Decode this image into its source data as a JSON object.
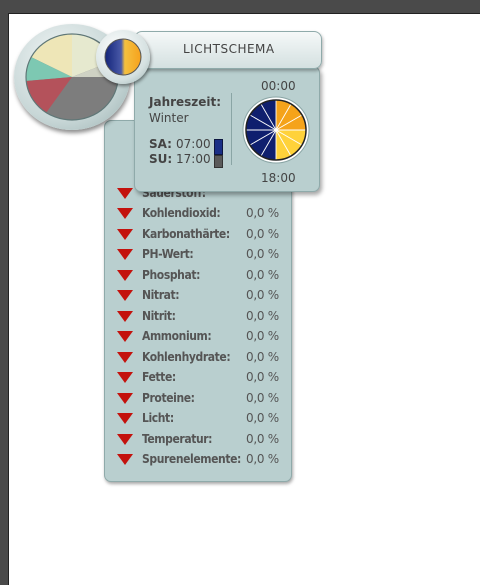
{
  "colors": {
    "panel_bg": "#b9cfcf",
    "arrow": "#c3120d",
    "sa_indicator": "#1a2f86",
    "su_indicator": "#5a5a5a"
  },
  "values": {
    "partial_label": "Sauerstoff:",
    "rows": [
      {
        "label": "Kohlendioxid:",
        "value": "0,0 %"
      },
      {
        "label": "Karbonathärte:",
        "value": "0,0 %"
      },
      {
        "label": "PH-Wert:",
        "value": "0,0 %"
      },
      {
        "label": "Phosphat:",
        "value": "0,0 %"
      },
      {
        "label": "Nitrat:",
        "value": "0,0 %"
      },
      {
        "label": "Nitrit:",
        "value": "0,0 %"
      },
      {
        "label": "Ammonium:",
        "value": "0,0 %"
      },
      {
        "label": "Kohlenhydrate:",
        "value": "0,0 %"
      },
      {
        "label": "Fette:",
        "value": "0,0 %"
      },
      {
        "label": "Proteine:",
        "value": "0,0 %"
      },
      {
        "label": "Licht:",
        "value": "0,0 %"
      },
      {
        "label": "Temperatur:",
        "value": "0,0 %"
      },
      {
        "label": "Spurenelemente:",
        "value": "0,0 %"
      }
    ],
    "row_icon": "triangle-down-icon"
  },
  "light_schema": {
    "title": "LICHTSCHEMA",
    "season_label": "Jahreszeit:",
    "season_value": "Winter",
    "sa_label": "SA:",
    "sa_time": "07:00",
    "su_label": "SU:",
    "su_time": "17:00",
    "clock_top": "00:00",
    "clock_bottom": "18:00",
    "clock_icon": "day-night-clock-icon",
    "orb_icon": "sun-moon-icon"
  },
  "pie_widget": {
    "icon": "pie-chart-icon"
  }
}
